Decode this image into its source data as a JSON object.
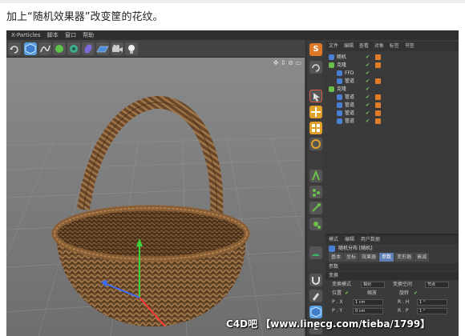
{
  "caption": "加上“随机效果器”改变筐的花纹。",
  "app": {
    "title": "X-Particles",
    "menu": [
      "X-Particles",
      "脚本",
      "窗口",
      "帮助"
    ]
  },
  "toolbar": {
    "icons": [
      "undo-icon",
      "cube-icon",
      "spline-icon",
      "generator-icon",
      "cloner-icon",
      "deformer-icon",
      "floor-icon",
      "camera-icon",
      "light-icon"
    ]
  },
  "viewport": {
    "header_icons": "✥ ⇕ ⊘ ▭"
  },
  "right_toolbar": {
    "icons": [
      "scale-s-icon",
      "undo-icon",
      "select-arrow-icon",
      "move-icon",
      "grid-icon",
      "rotate-icon",
      "mograph-icon",
      "effector-icon",
      "effector-icon",
      "effector-icon",
      "turtle-icon",
      "magnet-icon",
      "paint-icon",
      "cube-icon",
      "effector-icon",
      "texture-l-icon"
    ]
  },
  "object_manager": {
    "menu": [
      "文件",
      "编辑",
      "查看",
      "对象",
      "标签",
      "书签"
    ],
    "rows": [
      {
        "name": "随机",
        "indent": 0,
        "icon_color": "#4a7fd6",
        "tag_color": "#e07b2a"
      },
      {
        "name": "克隆",
        "indent": 0,
        "icon_color": "#6abf4b",
        "tag_color": "#e07b2a"
      },
      {
        "name": "FFD",
        "indent": 1,
        "icon_color": "#4a7fd6",
        "tag_color": ""
      },
      {
        "name": "管道",
        "indent": 1,
        "icon_color": "#4a7fd6",
        "tag_color": "#e07b2a"
      },
      {
        "name": "克隆",
        "indent": 0,
        "icon_color": "#6abf4b",
        "tag_color": ""
      },
      {
        "name": "管道",
        "indent": 1,
        "icon_color": "#4a7fd6",
        "tag_color": "#e07b2a"
      },
      {
        "name": "管道",
        "indent": 1,
        "icon_color": "#4a7fd6",
        "tag_color": "#e07b2a"
      },
      {
        "name": "管道",
        "indent": 1,
        "icon_color": "#4a7fd6",
        "tag_color": "#e07b2a"
      },
      {
        "name": "管道",
        "indent": 1,
        "icon_color": "#4a7fd6",
        "tag_color": "#e07b2a"
      }
    ]
  },
  "attribute_manager": {
    "menu": [
      "模式",
      "编辑",
      "用户数据"
    ],
    "title": "随机分布 [随机]",
    "tabs": [
      "基本",
      "坐标",
      "效果器",
      "参数",
      "变形器",
      "衰减"
    ],
    "active_tab": 3,
    "section_param": "参数",
    "section_transform": "变换",
    "transform_mode_label": "变换模式",
    "transform_mode_value": "相对",
    "transform_space_label": "变换空间",
    "transform_space_value": "节点",
    "position_label": "位置",
    "scale_label": "缩放",
    "rotate_label": "旋转",
    "px_label": "P . X",
    "px_value": "1 cm",
    "py_label": "P . Y",
    "py_value": "0 cm",
    "rh_label": "R . H",
    "rh_value": "1 °",
    "rp_label": "R . P",
    "rp_value": "1 °"
  },
  "watermark": "C4D吧  【www.linecg.com/tieba/1799】"
}
